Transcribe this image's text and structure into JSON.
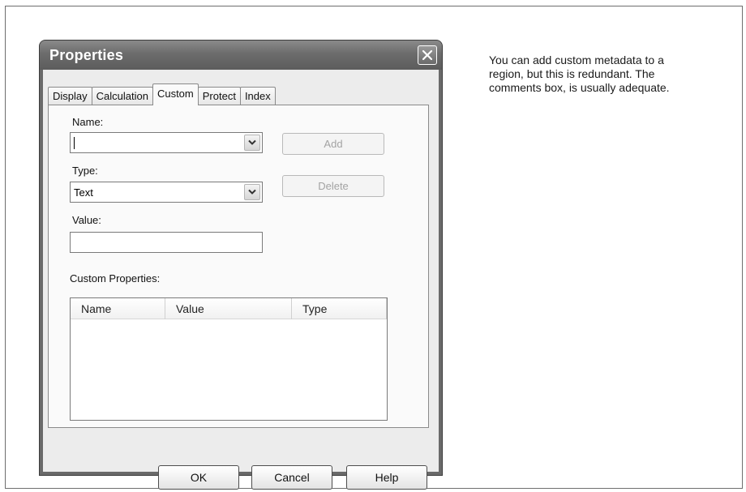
{
  "caption": {
    "line1": "You can add custom metadata to a",
    "line2": "region, but this is redundant.  The",
    "line3": "comments box, is usually adequate."
  },
  "dialog": {
    "title": "Properties",
    "tabs": [
      {
        "label": "Display",
        "active": false
      },
      {
        "label": "Calculation",
        "active": false
      },
      {
        "label": "Custom",
        "active": true
      },
      {
        "label": "Protect",
        "active": false
      },
      {
        "label": "Index",
        "active": false
      }
    ],
    "name_field": {
      "label": "Name:",
      "value": ""
    },
    "type_field": {
      "label": "Type:",
      "value": "Text"
    },
    "value_field": {
      "label": "Value:",
      "value": ""
    },
    "add_button": "Add",
    "delete_button": "Delete",
    "custom_properties": {
      "label": "Custom Properties:",
      "columns": [
        "Name",
        "Value",
        "Type"
      ],
      "rows": []
    },
    "footer": {
      "ok": "OK",
      "cancel": "Cancel",
      "help": "Help"
    }
  },
  "colors": {
    "title_text": "#ffffff",
    "disabled_text": "#a3a3a3"
  },
  "icons": {
    "close": "close-icon",
    "dropdown": "chevron-down-icon"
  }
}
